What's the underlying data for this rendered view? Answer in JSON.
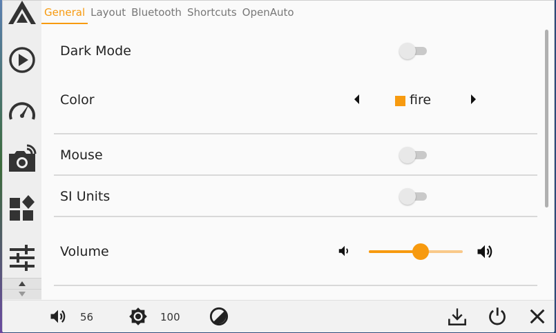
{
  "tabs": [
    {
      "label": "General",
      "active": true
    },
    {
      "label": "Layout",
      "active": false
    },
    {
      "label": "Bluetooth",
      "active": false
    },
    {
      "label": "Shortcuts",
      "active": false
    },
    {
      "label": "OpenAuto",
      "active": false
    }
  ],
  "sidebar": {
    "items": [
      {
        "icon": "logo-icon"
      },
      {
        "icon": "play-icon"
      },
      {
        "icon": "speedometer-icon"
      },
      {
        "icon": "camera-icon"
      },
      {
        "icon": "widgets-icon"
      },
      {
        "icon": "tune-icon"
      }
    ]
  },
  "settings": {
    "dark_mode": {
      "label": "Dark Mode",
      "on": false
    },
    "color": {
      "label": "Color",
      "value": "fire",
      "swatch": "#f79a0f"
    },
    "mouse": {
      "label": "Mouse",
      "on": false
    },
    "si_units": {
      "label": "SI Units",
      "on": false
    },
    "volume": {
      "label": "Volume",
      "level": 0.55
    }
  },
  "bottombar": {
    "volume_value": "56",
    "brightness_value": "100"
  },
  "colors": {
    "accent": "#f79a0f",
    "accent_light": "#f9c98a"
  }
}
